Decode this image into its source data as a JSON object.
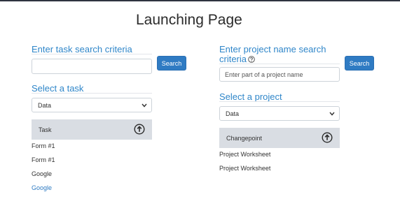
{
  "page": {
    "title": "Launching Page"
  },
  "task": {
    "search_label": "Enter task search criteria",
    "search_value": "",
    "search_placeholder": "",
    "search_button": "Search",
    "select_label": "Select a task",
    "select_value": "Data",
    "list_header": "Task",
    "items": [
      {
        "label": "Form #1",
        "link": false
      },
      {
        "label": "Form #1",
        "link": false
      },
      {
        "label": "Google",
        "link": false
      },
      {
        "label": "Google",
        "link": true
      }
    ]
  },
  "project": {
    "search_label_line1": "Enter project name search",
    "search_label_line2": "criteria",
    "search_placeholder": "Enter part of a project name",
    "search_button": "Search",
    "select_label": "Select a project",
    "select_value": "Data",
    "list_header": "Changepoint",
    "items": [
      {
        "label": "Project Worksheet"
      },
      {
        "label": "Project Worksheet"
      }
    ]
  },
  "icons": {
    "help": "question-circle-icon",
    "sort": "arrow-up-circle-icon",
    "dropdown": "chevron-down-icon"
  },
  "colors": {
    "accent": "#2f86c9",
    "button": "#2f7bc3",
    "header_bg": "#d9dde3"
  }
}
